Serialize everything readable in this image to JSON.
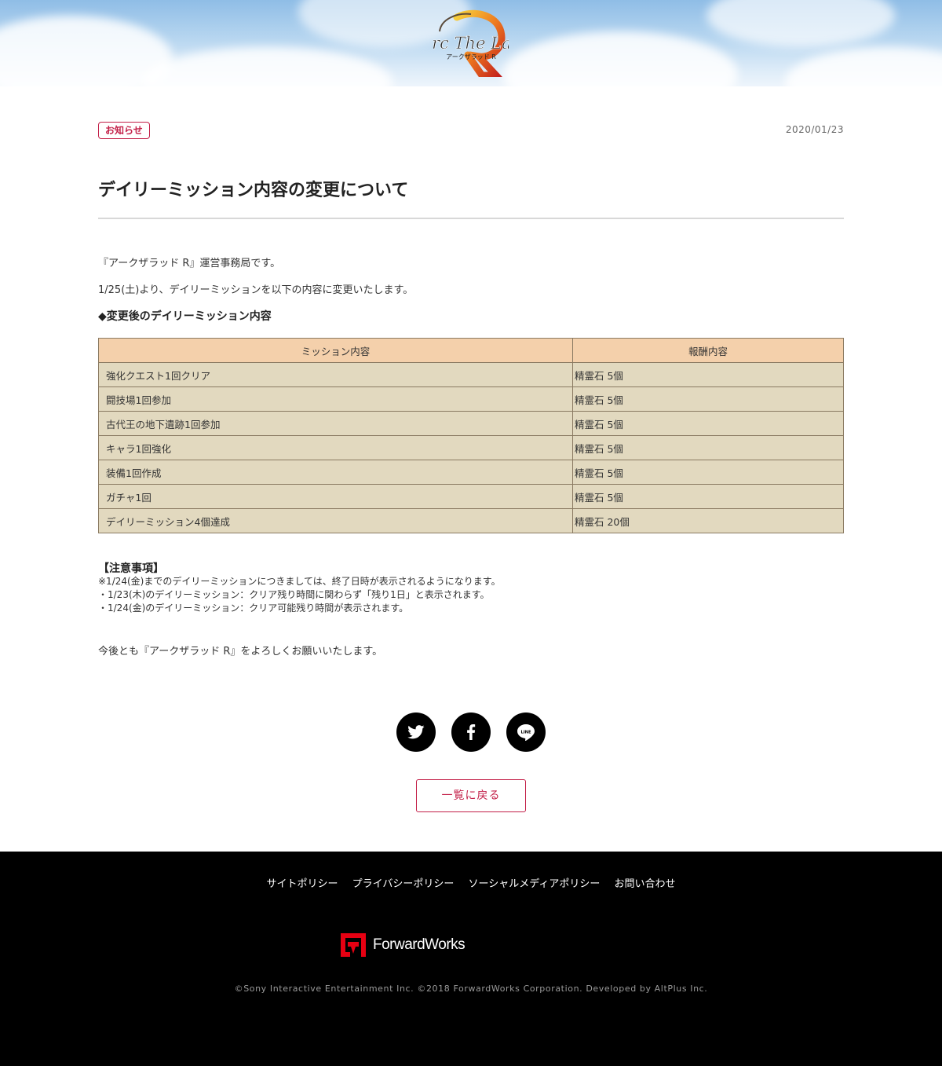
{
  "header": {
    "logo_text": "Arc The Lad",
    "logo_sub": "アークザラッド R"
  },
  "article": {
    "category": "お知らせ",
    "date": "2020/01/23",
    "title": "デイリーミッション内容の変更について",
    "intro": "『アークザラッド R』運営事務局です。",
    "lead": "1/25(土)より、デイリーミッションを以下の内容に変更いたします。",
    "subheading": "◆変更後のデイリーミッション内容",
    "table": {
      "headers": [
        "ミッション内容",
        "報酬内容"
      ],
      "rows": [
        [
          "強化クエスト1回クリア",
          "精霊石 5個"
        ],
        [
          "闘技場1回参加",
          "精霊石 5個"
        ],
        [
          "古代王の地下遺跡1回参加",
          "精霊石 5個"
        ],
        [
          "キャラ1回強化",
          "精霊石 5個"
        ],
        [
          "装備1回作成",
          "精霊石 5個"
        ],
        [
          "ガチャ1回",
          "精霊石 5個"
        ],
        [
          "デイリーミッション4個達成",
          "精霊石 20個"
        ]
      ]
    },
    "notes_heading": "【注意事項】",
    "notes": [
      "※1/24(金)までのデイリーミッションにつきましては、終了日時が表示されるようになります。",
      "・1/23(木)のデイリーミッション：クリア残り時間に関わらず「残り1日」と表示されます。",
      "・1/24(金)のデイリーミッション：クリア可能残り時間が表示されます。"
    ],
    "closing": "今後とも『アークザラッド R』をよろしくお願いいたします。"
  },
  "social": {
    "icons": [
      "twitter-icon",
      "facebook-icon",
      "line-icon"
    ],
    "line_label": "LINE"
  },
  "back_button": "一覧に戻る",
  "footer": {
    "links": [
      "サイトポリシー",
      "プライバシーポリシー",
      "ソーシャルメディアポリシー",
      "お問い合わせ"
    ],
    "brand": "ForwardWorks",
    "copyright": "©Sony Interactive Entertainment Inc. ©2018 ForwardWorks Corporation. Developed by AltPlus Inc."
  },
  "colors": {
    "accent": "#c31f48",
    "table_header": "#f4d0ab",
    "table_cell": "#e2d9bf",
    "table_border": "#8a7a62",
    "footer_bg": "#000000",
    "brand_red": "#e60012"
  }
}
